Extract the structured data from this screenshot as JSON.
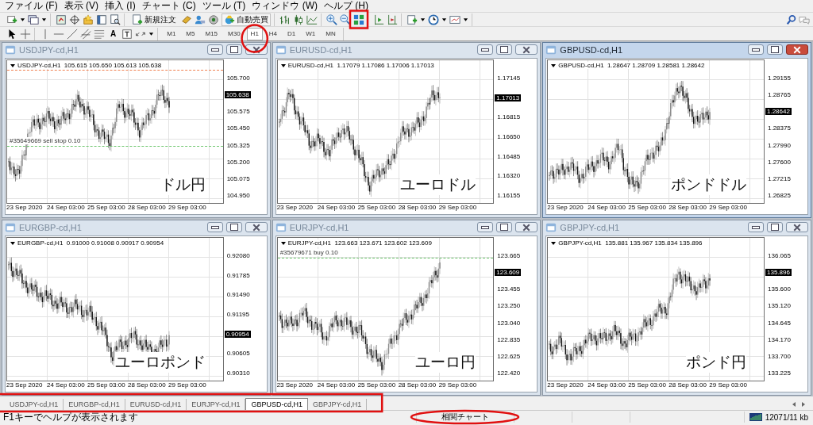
{
  "menu": [
    "ファイル (F)",
    "表示 (V)",
    "挿入 (I)",
    "チャート (C)",
    "ツール (T)",
    "ウィンドウ (W)",
    "ヘルプ (H)"
  ],
  "toolbar": {
    "new_order": "新規注文",
    "auto_trading": "自動売買",
    "text_tool": "A"
  },
  "timeframes": [
    {
      "label": "M1",
      "selected": false
    },
    {
      "label": "M5",
      "selected": false
    },
    {
      "label": "M15",
      "selected": false
    },
    {
      "label": "M30",
      "selected": false
    },
    {
      "label": "H1",
      "selected": true
    },
    {
      "label": "H4",
      "selected": false
    },
    {
      "label": "D1",
      "selected": false
    },
    {
      "label": "W1",
      "selected": false
    },
    {
      "label": "MN",
      "selected": false
    }
  ],
  "charts": [
    {
      "title": "USDJPY-cd,H1",
      "active": false,
      "header": "USDJPY-cd,H1  105.615 105.650 105.613 105.638",
      "note": "ドル円",
      "order_line": "#35649669 sell stop 0.10",
      "stop_line": true,
      "ticks": [
        {
          "kind": "tick",
          "text": "105.700"
        },
        {
          "kind": "current",
          "text": "105.638"
        },
        {
          "kind": "tick",
          "text": "105.575"
        },
        {
          "kind": "tick",
          "text": "105.450"
        },
        {
          "kind": "tick",
          "text": "105.325"
        },
        {
          "kind": "tick",
          "text": "105.200"
        },
        {
          "kind": "tick",
          "text": "105.075"
        },
        {
          "kind": "tick",
          "text": "104.950"
        }
      ],
      "dates": [
        "23 Sep 2020",
        "24 Sep 03:00",
        "25 Sep 03:00",
        "28 Sep 03:00",
        "29 Sep 03:00"
      ]
    },
    {
      "title": "EURUSD-cd,H1",
      "active": false,
      "header": "EURUSD-cd,H1  1.17079 1.17086 1.17006 1.17013",
      "note": "ユーロドル",
      "ticks": [
        {
          "kind": "tick",
          "text": "1.17145"
        },
        {
          "kind": "current",
          "text": "1.17013"
        },
        {
          "kind": "tick",
          "text": "1.16815"
        },
        {
          "kind": "tick",
          "text": "1.16650"
        },
        {
          "kind": "tick",
          "text": "1.16485"
        },
        {
          "kind": "tick",
          "text": "1.16320"
        },
        {
          "kind": "tick",
          "text": "1.16155"
        }
      ],
      "dates": [
        "23 Sep 2020",
        "24 Sep 03:00",
        "25 Sep 03:00",
        "28 Sep 03:00",
        "29 Sep 03:00"
      ]
    },
    {
      "title": "GBPUSD-cd,H1",
      "active": true,
      "header": "GBPUSD-cd,H1  1.28647 1.28709 1.28581 1.28642",
      "note": "ポンドドル",
      "ticks": [
        {
          "kind": "tick",
          "text": "1.29155"
        },
        {
          "kind": "tick",
          "text": "1.28765"
        },
        {
          "kind": "current",
          "text": "1.28642"
        },
        {
          "kind": "tick",
          "text": "1.28375"
        },
        {
          "kind": "tick",
          "text": "1.27990"
        },
        {
          "kind": "tick",
          "text": "1.27600"
        },
        {
          "kind": "tick",
          "text": "1.27215"
        },
        {
          "kind": "tick",
          "text": "1.26825"
        }
      ],
      "dates": [
        "23 Sep 2020",
        "24 Sep 03:00",
        "25 Sep 03:00",
        "28 Sep 03:00",
        "29 Sep 03:00"
      ]
    },
    {
      "title": "EURGBP-cd,H1",
      "active": false,
      "header": "EURGBP-cd,H1  0.91000 0.91008 0.90917 0.90954",
      "note": "ユーロポンド",
      "ticks": [
        {
          "kind": "tick",
          "text": "0.92080"
        },
        {
          "kind": "tick",
          "text": "0.91785"
        },
        {
          "kind": "tick",
          "text": "0.91490"
        },
        {
          "kind": "tick",
          "text": "0.91195"
        },
        {
          "kind": "current",
          "text": "0.90954"
        },
        {
          "kind": "tick",
          "text": "0.90605"
        },
        {
          "kind": "tick",
          "text": "0.90310"
        }
      ],
      "dates": [
        "23 Sep 2020",
        "24 Sep 03:00",
        "25 Sep 03:00",
        "28 Sep 03:00",
        "29 Sep 03:00"
      ]
    },
    {
      "title": "EURJPY-cd,H1",
      "active": false,
      "header": "EURJPY-cd,H1  123.663 123.671 123.602 123.609",
      "note": "ユーロ円",
      "order_line": "#35679671 buy 0.10",
      "ticks": [
        {
          "kind": "tick",
          "text": "123.665"
        },
        {
          "kind": "current",
          "text": "123.609"
        },
        {
          "kind": "tick",
          "text": "123.455"
        },
        {
          "kind": "tick",
          "text": "123.250"
        },
        {
          "kind": "tick",
          "text": "123.040"
        },
        {
          "kind": "tick",
          "text": "122.835"
        },
        {
          "kind": "tick",
          "text": "122.625"
        },
        {
          "kind": "tick",
          "text": "122.420"
        }
      ],
      "dates": [
        "23 Sep 2020",
        "24 Sep 03:00",
        "25 Sep 03:00",
        "28 Sep 03:00",
        "29 Sep 03:00"
      ]
    },
    {
      "title": "GBPJPY-cd,H1",
      "active": false,
      "header": "GBPJPY-cd,H1  135.881 135.967 135.834 135.896",
      "note": "ポンド円",
      "ticks": [
        {
          "kind": "tick",
          "text": "136.065"
        },
        {
          "kind": "current",
          "text": "135.896"
        },
        {
          "kind": "tick",
          "text": "135.600"
        },
        {
          "kind": "tick",
          "text": "135.120"
        },
        {
          "kind": "tick",
          "text": "134.645"
        },
        {
          "kind": "tick",
          "text": "134.170"
        },
        {
          "kind": "tick",
          "text": "133.700"
        },
        {
          "kind": "tick",
          "text": "133.225"
        }
      ],
      "dates": [
        "23 Sep 2020",
        "24 Sep 03:00",
        "25 Sep 03:00",
        "28 Sep 03:00",
        "29 Sep 03:00"
      ]
    }
  ],
  "tabs": [
    {
      "label": "USDJPY-cd,H1",
      "selected": false
    },
    {
      "label": "EURGBP-cd,H1",
      "selected": false
    },
    {
      "label": "EURUSD-cd,H1",
      "selected": false
    },
    {
      "label": "EURJPY-cd,H1",
      "selected": false
    },
    {
      "label": "GBPUSD-cd,H1",
      "selected": true
    },
    {
      "label": "GBPJPY-cd,H1",
      "selected": false
    }
  ],
  "status_bar": {
    "help": "F1キーでヘルプが表示されます",
    "profile": "相関チャート",
    "traffic": "12071/11 kb"
  },
  "markup": [
    {
      "kind": "rectangle"
    },
    {
      "kind": "ellipse"
    },
    {
      "kind": "rectangle"
    },
    {
      "kind": "ellipse"
    }
  ]
}
